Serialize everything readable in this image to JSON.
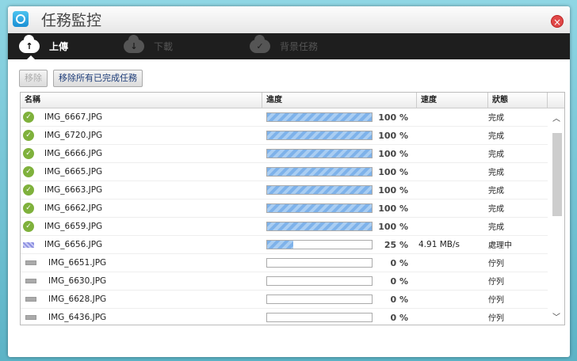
{
  "window": {
    "title": "任務監控"
  },
  "tabs": [
    {
      "label": "上傳",
      "icon": "upload-cloud-icon",
      "active": true
    },
    {
      "label": "下載",
      "icon": "download-cloud-icon"
    },
    {
      "label": "背景任務",
      "icon": "background-task-cloud-icon"
    }
  ],
  "toolbar": {
    "remove": "移除",
    "remove_completed": "移除所有已完成任務"
  },
  "table": {
    "headers": [
      "名稱",
      "進度",
      "速度",
      "狀態"
    ],
    "rows": [
      {
        "name": "IMG_6667.JPG",
        "progress": 100,
        "pct": "100 %",
        "speed": "",
        "status": "完成",
        "state": "done"
      },
      {
        "name": "IMG_6720.JPG",
        "progress": 100,
        "pct": "100 %",
        "speed": "",
        "status": "完成",
        "state": "done"
      },
      {
        "name": "IMG_6666.JPG",
        "progress": 100,
        "pct": "100 %",
        "speed": "",
        "status": "完成",
        "state": "done"
      },
      {
        "name": "IMG_6665.JPG",
        "progress": 100,
        "pct": "100 %",
        "speed": "",
        "status": "完成",
        "state": "done"
      },
      {
        "name": "IMG_6663.JPG",
        "progress": 100,
        "pct": "100 %",
        "speed": "",
        "status": "完成",
        "state": "done"
      },
      {
        "name": "IMG_6662.JPG",
        "progress": 100,
        "pct": "100 %",
        "speed": "",
        "status": "完成",
        "state": "done"
      },
      {
        "name": "IMG_6659.JPG",
        "progress": 100,
        "pct": "100 %",
        "speed": "",
        "status": "完成",
        "state": "done"
      },
      {
        "name": "IMG_6656.JPG",
        "progress": 25,
        "pct": "25 %",
        "speed": "4.91 MB/s",
        "status": "處理中",
        "state": "processing"
      },
      {
        "name": "IMG_6651.JPG",
        "progress": 0,
        "pct": "0 %",
        "speed": "",
        "status": "佇列",
        "state": "queued"
      },
      {
        "name": "IMG_6630.JPG",
        "progress": 0,
        "pct": "0 %",
        "speed": "",
        "status": "佇列",
        "state": "queued"
      },
      {
        "name": "IMG_6628.JPG",
        "progress": 0,
        "pct": "0 %",
        "speed": "",
        "status": "佇列",
        "state": "queued"
      },
      {
        "name": "IMG_6436.JPG",
        "progress": 0,
        "pct": "0 %",
        "speed": "",
        "status": "佇列",
        "state": "queued"
      }
    ]
  }
}
